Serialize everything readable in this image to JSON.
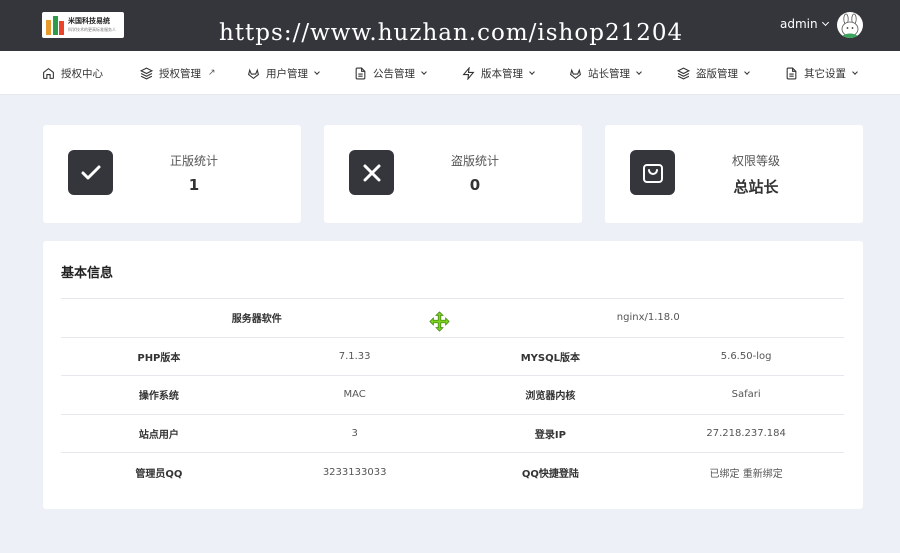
{
  "topbar": {
    "logo_name": "米国科技易统",
    "logo_sub": "科学技术的更高标准服务人",
    "watermark": "https://www.huzhan.com/ishop21204",
    "user_name": "admin"
  },
  "nav": [
    {
      "label": "授权中心",
      "icon": "home-icon"
    },
    {
      "label": "授权管理",
      "icon": "layers-icon",
      "ext": "↗"
    },
    {
      "label": "用户管理",
      "icon": "gitlab-icon"
    },
    {
      "label": "公告管理",
      "icon": "file-icon"
    },
    {
      "label": "版本管理",
      "icon": "zap-icon"
    },
    {
      "label": "站长管理",
      "icon": "gitlab-icon"
    },
    {
      "label": "盗版管理",
      "icon": "layers-icon"
    },
    {
      "label": "其它设置",
      "icon": "file-icon"
    }
  ],
  "stats": [
    {
      "label": "正版统计",
      "value": "1",
      "icon": "check-icon"
    },
    {
      "label": "盗版统计",
      "value": "0",
      "icon": "x-icon"
    },
    {
      "label": "权限等级",
      "value": "总站长",
      "icon": "shopping-bag-icon"
    }
  ],
  "panel": {
    "title": "基本信息",
    "server_label": "服务器软件",
    "server_value": "nginx/1.18.0",
    "rows": [
      {
        "k1": "PHP版本",
        "v1": "7.1.33",
        "k2": "MYSQL版本",
        "v2": "5.6.50-log"
      },
      {
        "k1": "操作系统",
        "v1": "MAC",
        "k2": "浏览器内核",
        "v2": "Safari"
      },
      {
        "k1": "站点用户",
        "v1": "3",
        "k2": "登录IP",
        "v2": "27.218.237.184"
      },
      {
        "k1": "管理员QQ",
        "v1": "3233133033",
        "k2": "QQ快捷登陆",
        "v2": "已绑定 重新绑定"
      }
    ]
  },
  "colors": {
    "topbar": "#34363c",
    "background": "#eef0f7",
    "card": "#ffffff",
    "icon_box": "#34363c"
  }
}
